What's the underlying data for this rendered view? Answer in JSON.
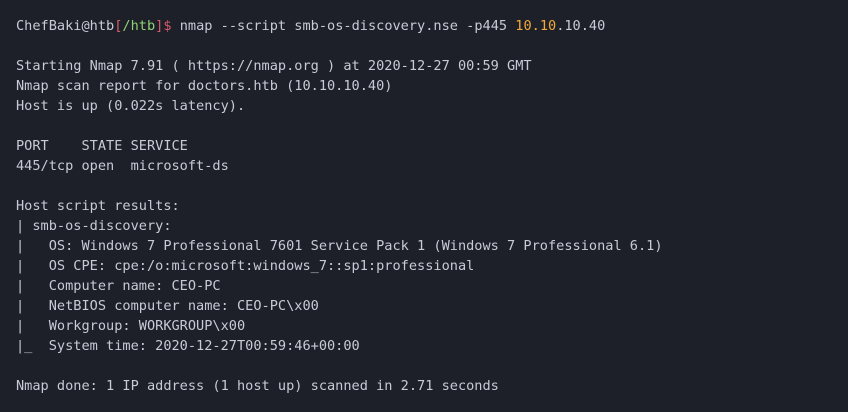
{
  "prompt": {
    "user_host": "ChefBaki@htb",
    "bracket_open": "[",
    "dir": "/htb",
    "bracket_close": "]",
    "symbol": "$",
    "command_prefix": " nmap --script smb-os-discovery.nse -p445 ",
    "ip_highlight": "10.10",
    "ip_rest": ".10.40"
  },
  "output": {
    "starting": "Starting Nmap 7.91 ( https://nmap.org ) at 2020-12-27 00:59 GMT",
    "report": "Nmap scan report for doctors.htb (10.10.10.40)",
    "host_up": "Host is up (0.022s latency).",
    "port_header": "PORT    STATE SERVICE",
    "port_row": "445/tcp open  microsoft-ds",
    "script_results": "Host script results:",
    "smb_title": "| smb-os-discovery:",
    "os": "|   OS: Windows 7 Professional 7601 Service Pack 1 (Windows 7 Professional 6.1)",
    "os_cpe": "|   OS CPE: cpe:/o:microsoft:windows_7::sp1:professional",
    "computer_name": "|   Computer name: CEO-PC",
    "netbios": "|   NetBIOS computer name: CEO-PC\\x00",
    "workgroup": "|   Workgroup: WORKGROUP\\x00",
    "system_time": "|_  System time: 2020-12-27T00:59:46+00:00",
    "done": "Nmap done: 1 IP address (1 host up) scanned in 2.71 seconds"
  },
  "colors": {
    "background": "#1d2029",
    "text": "#c6cbd6",
    "prompt_accent": "#d55a6b",
    "directory": "#8fd072",
    "ip_highlight": "#f2a93b"
  }
}
